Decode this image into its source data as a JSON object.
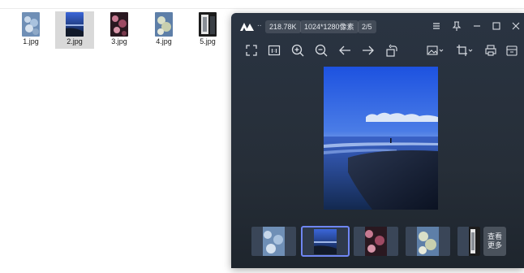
{
  "explorer": {
    "files": [
      {
        "name": "1.jpg",
        "selected": false
      },
      {
        "name": "2.jpg",
        "selected": true
      },
      {
        "name": "3.jpg",
        "selected": false
      },
      {
        "name": "4.jpg",
        "selected": false
      },
      {
        "name": "5.jpg",
        "selected": false
      }
    ]
  },
  "viewer": {
    "title_dots": "..",
    "file_size": "218.78K",
    "dimensions": "1024*1280像素",
    "position": "2/5",
    "window_icons": [
      "menu-icon",
      "pin-icon",
      "minimize-icon",
      "maximize-icon",
      "close-icon"
    ],
    "toolbar_icons": [
      "fullscreen-icon",
      "actual-size-icon",
      "zoom-in-icon",
      "zoom-out-icon",
      "previous-icon",
      "next-icon",
      "rotate-icon",
      "image-options-icon",
      "crop-icon",
      "print-icon",
      "save-icon"
    ],
    "more_button": "查看更多",
    "accent_color": "#6f86f3"
  }
}
